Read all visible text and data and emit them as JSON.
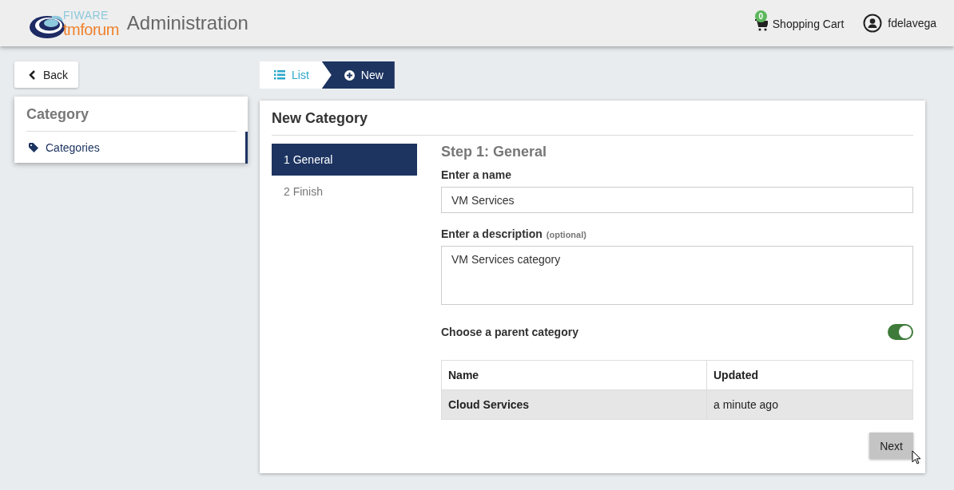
{
  "header": {
    "logo": {
      "top": "FIWARE",
      "bottom": "tmforum"
    },
    "title": "Administration",
    "cart": {
      "label": "Shopping Cart",
      "count": "0"
    },
    "user": {
      "name": "fdelavega"
    }
  },
  "back_button": "Back",
  "sidebar": {
    "title": "Category",
    "items": [
      {
        "label": "Categories",
        "selected": true
      }
    ]
  },
  "breadcrumb": [
    {
      "label": "List",
      "kind": "list",
      "selected": false
    },
    {
      "label": "New",
      "kind": "add",
      "selected": true
    }
  ],
  "panel": {
    "title": "New Category",
    "steps": [
      {
        "label": "1 General",
        "selected": true
      },
      {
        "label": "2 Finish",
        "selected": false
      }
    ],
    "step_title": "Step 1: General",
    "name_field": {
      "label": "Enter a name",
      "value": "VM Services"
    },
    "description_field": {
      "label": "Enter a description",
      "hint": "(optional)",
      "value": "VM Services category"
    },
    "parent_toggle": {
      "label": "Choose a parent category",
      "on": true
    },
    "table": {
      "columns": [
        "Name",
        "Updated"
      ],
      "rows": [
        {
          "cells": [
            "Cloud Services",
            "a minute ago"
          ],
          "selected": true
        }
      ]
    },
    "next_button": "Next"
  }
}
